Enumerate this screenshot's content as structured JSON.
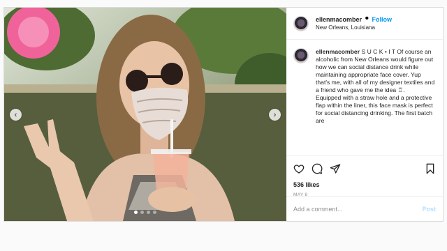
{
  "header": {
    "username": "ellenmacomber",
    "separator": "•",
    "follow_label": "Follow",
    "location": "New Orleans, Louisiana"
  },
  "caption": {
    "username": "ellenmacomber",
    "paragraph_1": "S U C K • I T Of course an alcoholic from New Orleans would figure out how we can social distance drink while maintaining appropriate face cover. Yup that's me, with all of my designer textiles and a friend who gave me the idea ♖.",
    "paragraph_2": "Equipped with a straw hole and a protective flap within the liner, this face mask is perfect for social distancing drinking. The first batch are"
  },
  "media": {
    "prev_glyph": "‹",
    "next_glyph": "›",
    "slide_count": 4,
    "active_slide": 1
  },
  "actions": {
    "likes": "536 likes",
    "date": "MAY 8",
    "icons": [
      "heart-icon",
      "comment-icon",
      "share-icon",
      "bookmark-icon"
    ]
  },
  "comment": {
    "placeholder": "Add a comment...",
    "post_label": "Post"
  },
  "colors": {
    "link_blue": "#0095f6",
    "post_disabled": "#b2dffc",
    "border": "#dbdbdb"
  }
}
